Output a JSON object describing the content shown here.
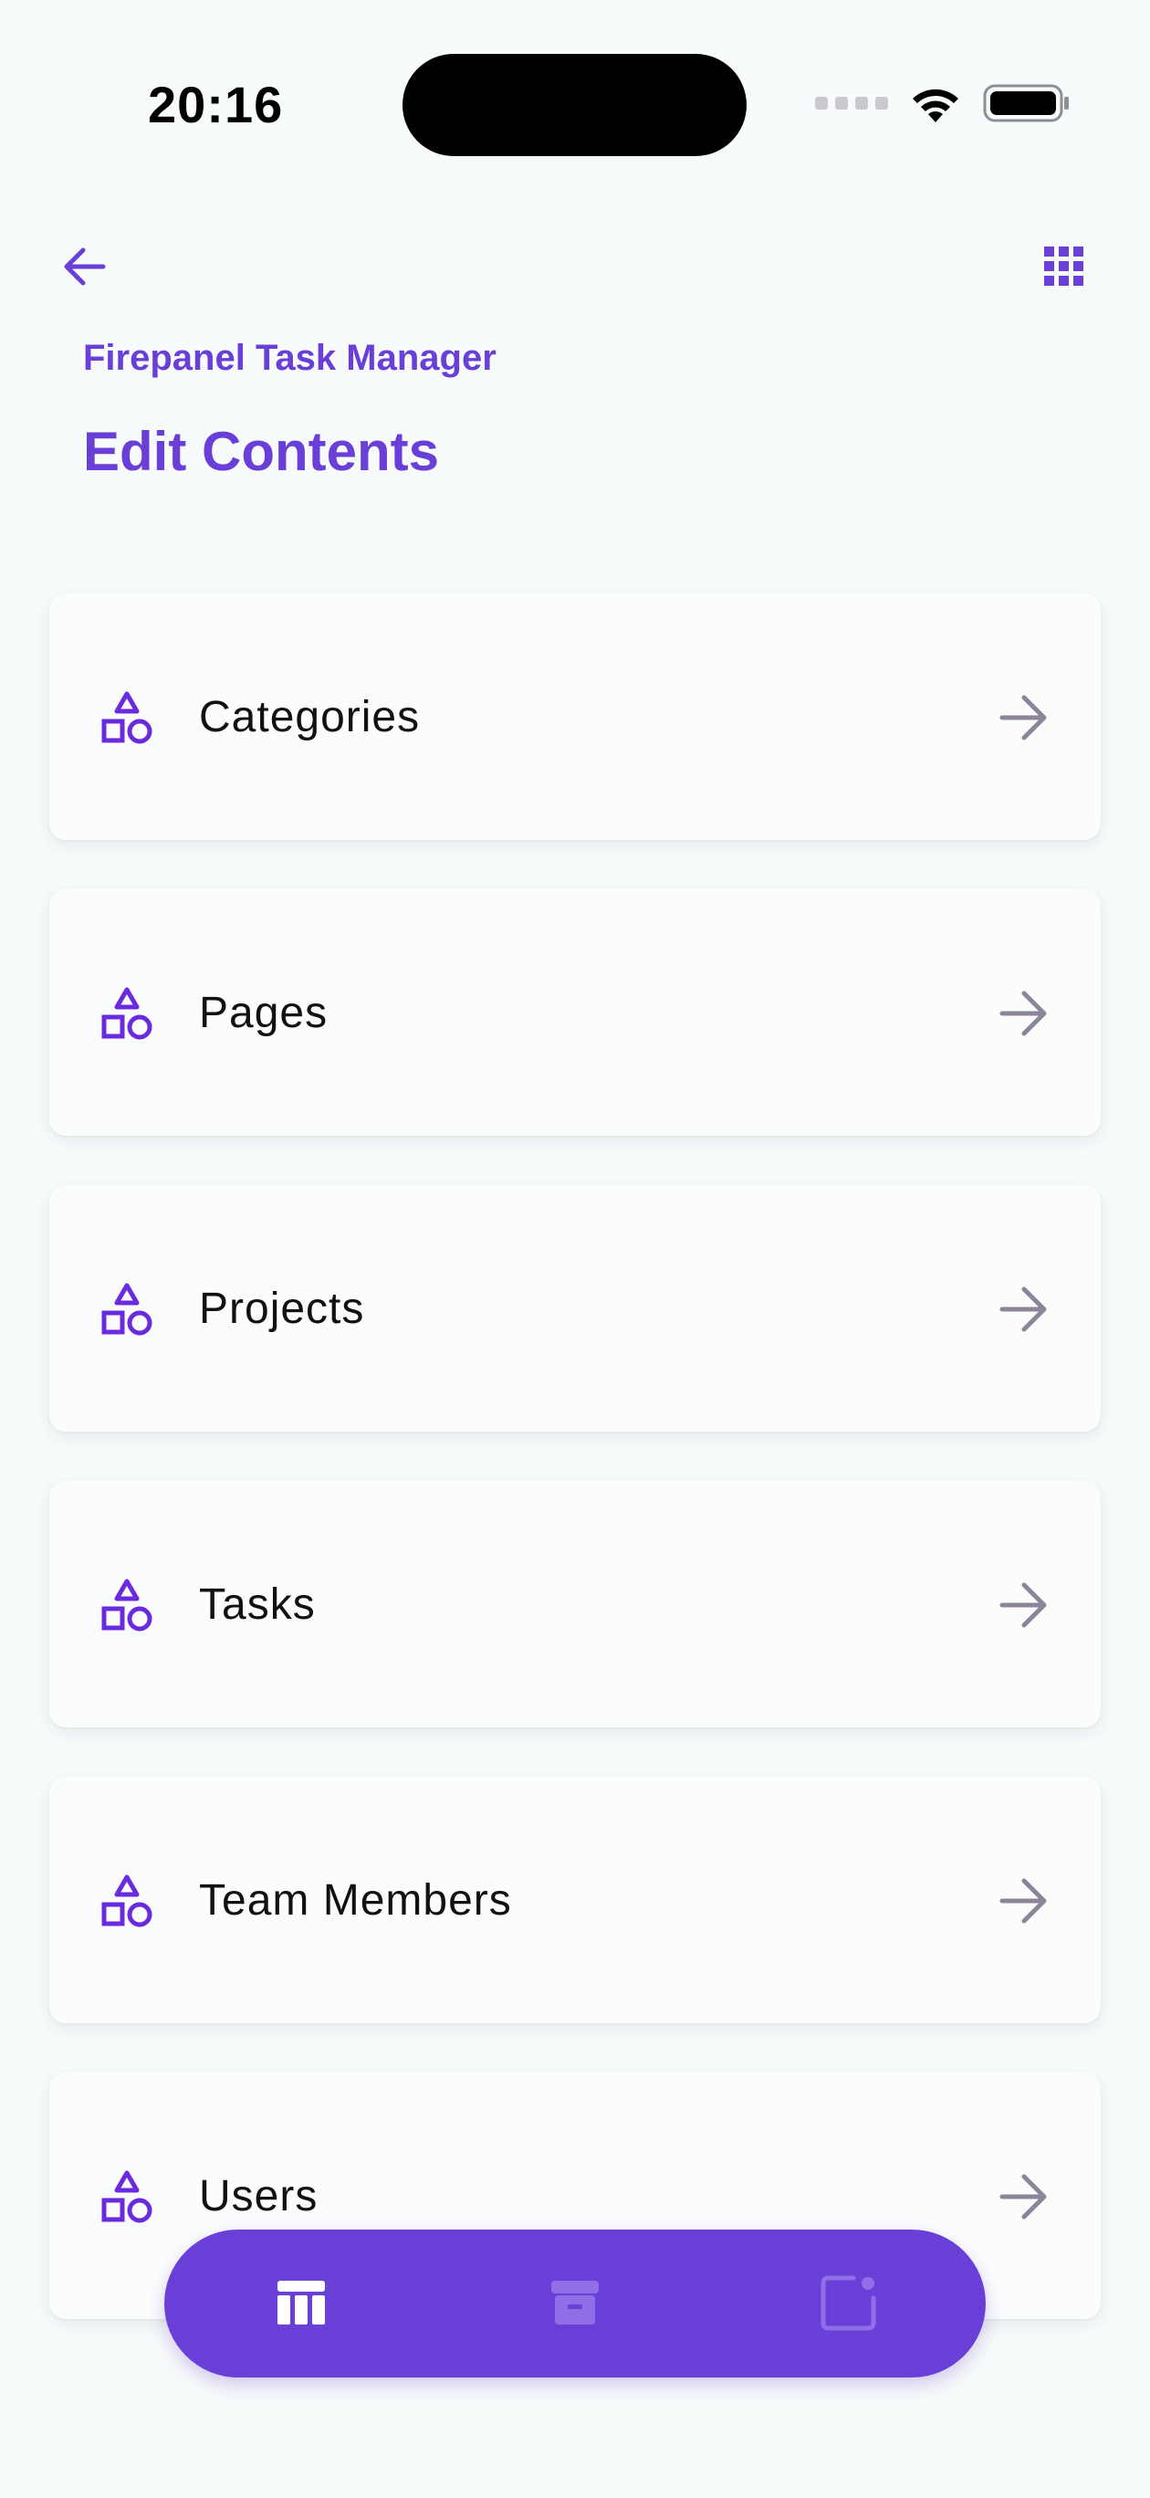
{
  "status_bar": {
    "time": "20:16"
  },
  "header": {
    "back_icon": "arrow-left-icon",
    "menu_icon": "grid-icon",
    "app_name": "Firepanel Task Manager",
    "title": "Edit Contents"
  },
  "content_types": [
    {
      "label": "Categories",
      "icon": "shapes-icon"
    },
    {
      "label": "Pages",
      "icon": "shapes-icon"
    },
    {
      "label": "Projects",
      "icon": "shapes-icon"
    },
    {
      "label": "Tasks",
      "icon": "shapes-icon"
    },
    {
      "label": "Team Members",
      "icon": "shapes-icon"
    },
    {
      "label": "Users",
      "icon": "shapes-icon"
    }
  ],
  "bottom_nav": {
    "items": [
      {
        "icon": "table-icon",
        "active": true
      },
      {
        "icon": "archive-icon",
        "active": false
      },
      {
        "icon": "notification-square-icon",
        "active": false
      }
    ]
  },
  "colors": {
    "accent": "#6a3fd8",
    "background": "#f8fbfb",
    "card": "#fbfdfd",
    "arrow": "#8c8599"
  }
}
